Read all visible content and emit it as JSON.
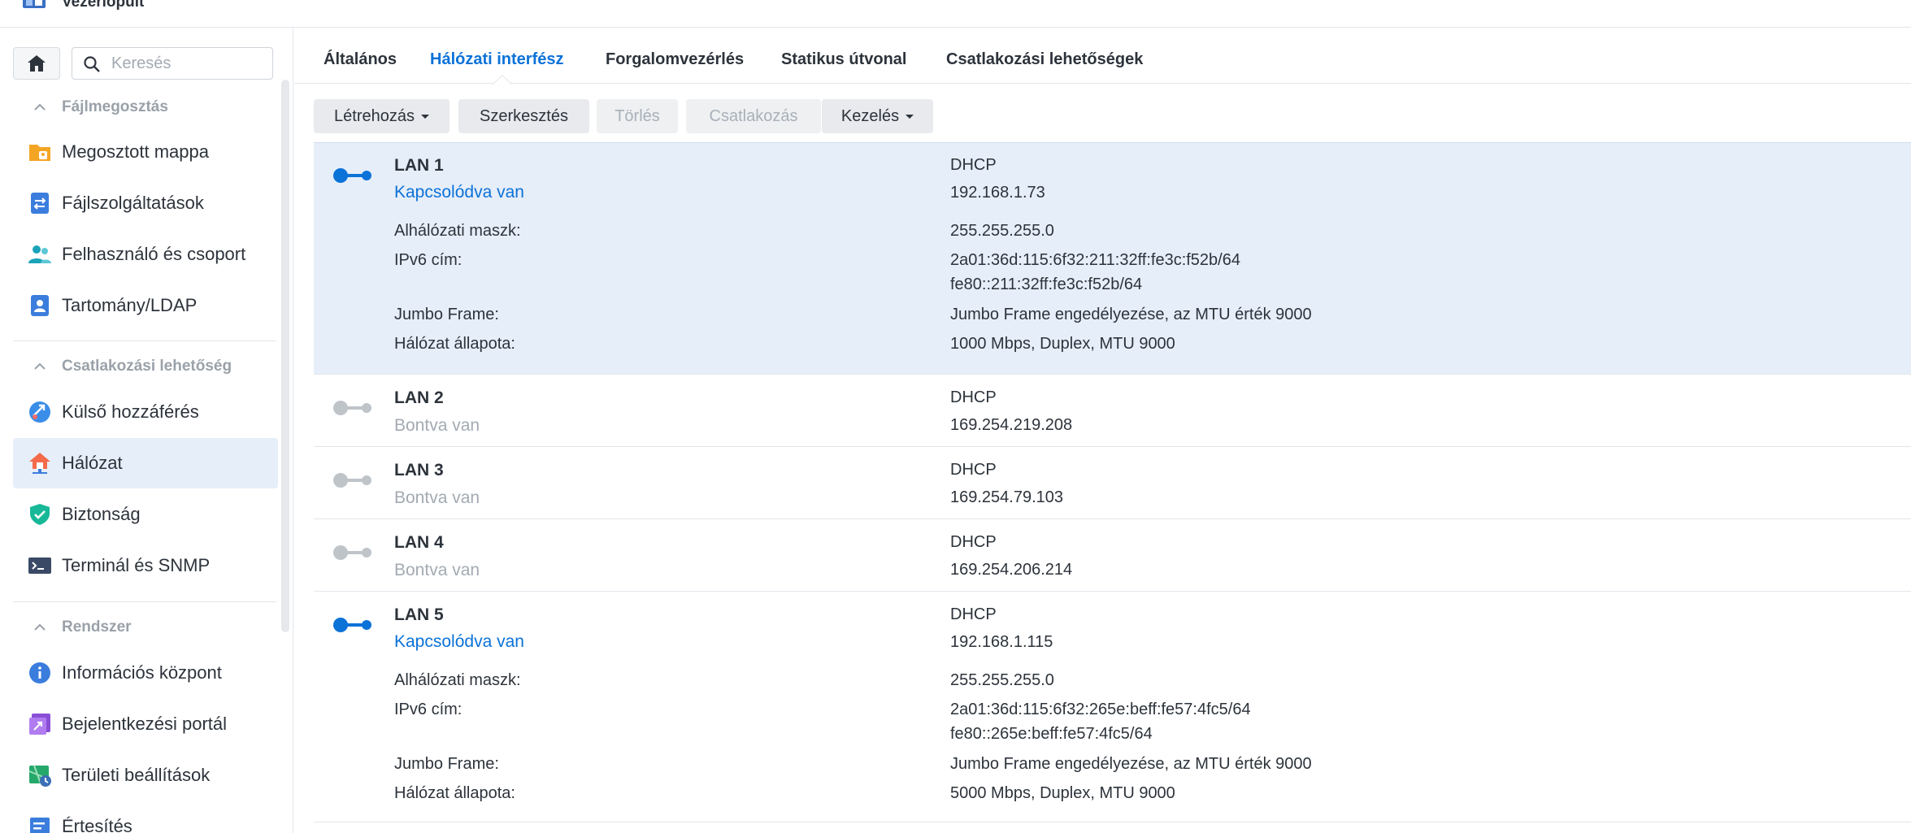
{
  "app": {
    "title": "Vezérlőpult"
  },
  "search": {
    "placeholder": "Keresés"
  },
  "sidebar": {
    "sections": [
      {
        "title": "Fájlmegosztás"
      },
      {
        "title": "Csatlakozási lehetőség"
      },
      {
        "title": "Rendszer"
      }
    ],
    "items": [
      {
        "label": "Megosztott mappa",
        "icon": "shared-folder-icon"
      },
      {
        "label": "Fájlszolgáltatások",
        "icon": "file-services-icon"
      },
      {
        "label": "Felhasználó és csoport",
        "icon": "user-group-icon"
      },
      {
        "label": "Tartomány/LDAP",
        "icon": "domain-ldap-icon"
      },
      {
        "label": "Külső hozzáférés",
        "icon": "external-access-icon"
      },
      {
        "label": "Hálózat",
        "icon": "network-icon"
      },
      {
        "label": "Biztonság",
        "icon": "security-shield-icon"
      },
      {
        "label": "Terminál és SNMP",
        "icon": "terminal-icon"
      },
      {
        "label": "Információs központ",
        "icon": "info-center-icon"
      },
      {
        "label": "Bejelentkezési portál",
        "icon": "login-portal-icon"
      },
      {
        "label": "Területi beállítások",
        "icon": "regional-options-icon"
      },
      {
        "label": "Értesítés",
        "icon": "notification-icon"
      }
    ]
  },
  "tabs": [
    {
      "label": "Általános"
    },
    {
      "label": "Hálózati interfész"
    },
    {
      "label": "Forgalomvezérlés"
    },
    {
      "label": "Statikus útvonal"
    },
    {
      "label": "Csatlakozási lehetőségek"
    }
  ],
  "toolbar": {
    "create": "Létrehozás",
    "edit": "Szerkesztés",
    "delete": "Törlés",
    "connect": "Csatlakozás",
    "manage": "Kezelés"
  },
  "labels": {
    "subnet": "Alhálózati maszk:",
    "ipv6": "IPv6 cím:",
    "jumbo": "Jumbo Frame:",
    "status": "Hálózat állapota:"
  },
  "interfaces": [
    {
      "name": "LAN 1",
      "state": "Kapcsolódva van",
      "mode": "DHCP",
      "ip": "192.168.1.73",
      "subnet": "255.255.255.0",
      "ipv6_1": "2a01:36d:115:6f32:211:32ff:fe3c:f52b/64",
      "ipv6_2": "fe80::211:32ff:fe3c:f52b/64",
      "jumbo": "Jumbo Frame engedélyezése, az MTU érték 9000",
      "status": "1000 Mbps, Duplex, MTU 9000"
    },
    {
      "name": "LAN 2",
      "state": "Bontva van",
      "mode": "DHCP",
      "ip": "169.254.219.208"
    },
    {
      "name": "LAN 3",
      "state": "Bontva van",
      "mode": "DHCP",
      "ip": "169.254.79.103"
    },
    {
      "name": "LAN 4",
      "state": "Bontva van",
      "mode": "DHCP",
      "ip": "169.254.206.214"
    },
    {
      "name": "LAN 5",
      "state": "Kapcsolódva van",
      "mode": "DHCP",
      "ip": "192.168.1.115",
      "subnet": "255.255.255.0",
      "ipv6_1": "2a01:36d:115:6f32:265e:beff:fe57:4fc5/64",
      "ipv6_2": "fe80::265e:beff:fe57:4fc5/64",
      "jumbo": "Jumbo Frame engedélyezése, az MTU érték 9000",
      "status": "5000 Mbps, Duplex, MTU 9000"
    }
  ],
  "colors": {
    "accent": "#0b72d8",
    "connected": "#0b72d8",
    "disconnected": "#bfc4c9",
    "selected_bg": "#e6eef9"
  }
}
